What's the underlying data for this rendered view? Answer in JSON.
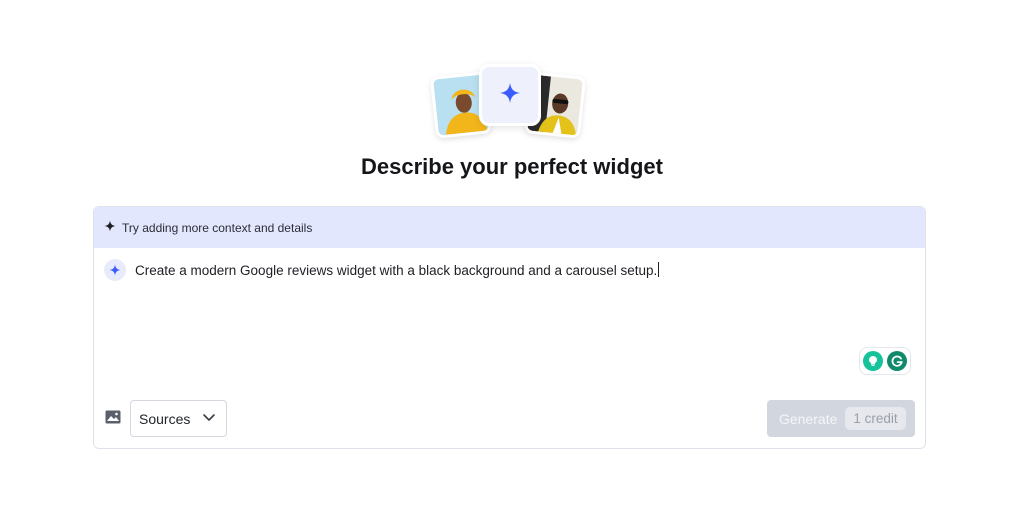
{
  "header": {
    "title": "Describe your perfect widget"
  },
  "hero": {
    "left_photo_icon": "person-photo",
    "center_icon": "sparkle-icon",
    "right_photo_icon": "person-photo"
  },
  "hint": {
    "icon": "sparkle-icon",
    "text": "Try adding more context and details"
  },
  "prompt": {
    "icon": "sparkle-icon",
    "value": "Create a modern Google reviews widget with a black background and a carousel setup."
  },
  "toolbar": {
    "image_icon": "image-icon",
    "sources_label": "Sources",
    "sources_icon": "chevron-down-icon",
    "generate_label": "Generate",
    "credit_label": "1 credit"
  },
  "extensions": {
    "grammarly_icons": [
      "bulb-icon",
      "grammarly-icon"
    ]
  },
  "colors": {
    "accent": "#3b5bfd",
    "hint_bg": "#e3e7fd",
    "generate_disabled": "#d2d6de"
  }
}
